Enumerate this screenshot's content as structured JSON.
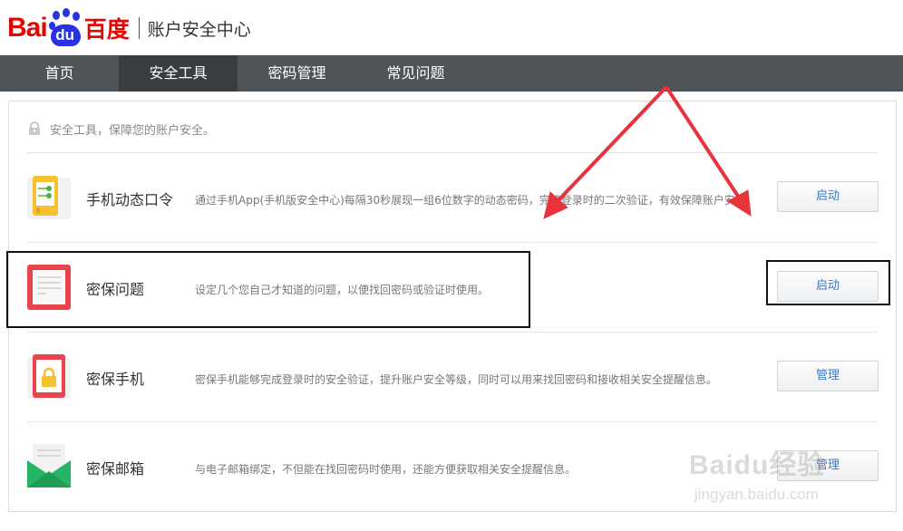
{
  "header": {
    "logo_left": "Bai",
    "logo_paw": "du",
    "logo_cn": "百度",
    "title": "账户安全中心"
  },
  "nav": {
    "items": [
      {
        "label": "首页"
      },
      {
        "label": "安全工具"
      },
      {
        "label": "密码管理"
      },
      {
        "label": "常见问题"
      }
    ],
    "active_index": 1
  },
  "panel": {
    "tip": "安全工具，保障您的账户安全。",
    "rows": [
      {
        "icon": "phone-token-icon",
        "name": "手机动态口令",
        "desc": "通过手机App(手机版安全中心)每隔30秒展现一组6位数字的动态密码，完成登录时的二次验证，有效保障账户安全。",
        "button": "启动"
      },
      {
        "icon": "security-question-icon",
        "name": "密保问题",
        "desc": "设定几个您自己才知道的问题，以便找回密码或验证时使用。",
        "button": "启动"
      },
      {
        "icon": "security-phone-icon",
        "name": "密保手机",
        "desc": "密保手机能够完成登录时的安全验证，提升账户安全等级，同时可以用来找回密码和接收相关安全提醒信息。",
        "button": "管理"
      },
      {
        "icon": "security-email-icon",
        "name": "密保邮箱",
        "desc": "与电子邮箱绑定，不但能在找回密码时使用，还能方便获取相关安全提醒信息。",
        "button": "管理"
      }
    ]
  },
  "watermark": {
    "brand": "Baidu经验",
    "url": "jingyan.baidu.com"
  },
  "colors": {
    "brand_red": "#e10601",
    "brand_blue": "#2932e1",
    "nav_bg": "#4f5458",
    "nav_active": "#3a3d40",
    "button_text": "#3b78c2",
    "arrow": "#e8323c"
  }
}
